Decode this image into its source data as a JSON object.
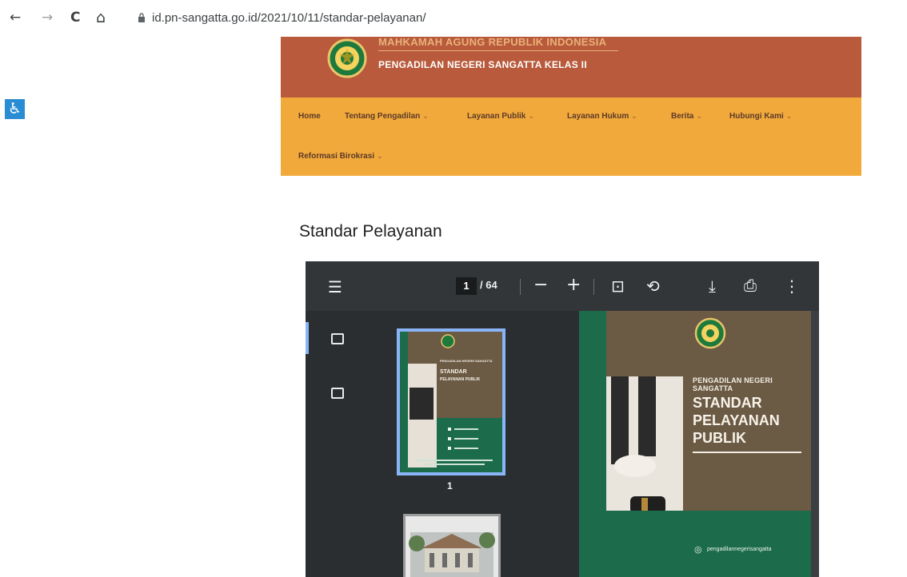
{
  "browser": {
    "url": "id.pn-sangatta.go.id/2021/10/11/standar-pelayanan/",
    "back": "←",
    "forward": "→",
    "reload": "C",
    "home": "⌂"
  },
  "accessibility": {
    "icon": "♿"
  },
  "header": {
    "top_text": "MAHKAMAH AGUNG REPUBLIK INDONESIA",
    "title": "PENGADILAN NEGERI SANGATTA KELAS II",
    "colors": {
      "header_bg": "#b85a3b",
      "menu_bg": "#f2a93b"
    }
  },
  "menu": {
    "items": [
      {
        "label": "Home",
        "dropdown": false
      },
      {
        "label": "Tentang Pengadilan",
        "dropdown": true
      },
      {
        "label": "Layanan Publik",
        "dropdown": true
      },
      {
        "label": "Layanan Hukum",
        "dropdown": true
      },
      {
        "label": "Berita",
        "dropdown": true
      },
      {
        "label": "Hubungi Kami",
        "dropdown": true
      },
      {
        "label": "Reformasi Birokrasi",
        "dropdown": true
      }
    ],
    "chevron": "⌄"
  },
  "main": {
    "title": "Standar Pelayanan"
  },
  "pdf": {
    "current_page": "1",
    "total_pages": "/ 64",
    "icons": {
      "menu": "☰",
      "zoom_out": "−",
      "zoom_in": "+",
      "fit": "⊡",
      "rotate": "⟲",
      "download": "⤓",
      "print": "⎙",
      "more": "⋮"
    },
    "thumbnail_label": "1",
    "page": {
      "subtitle": "PENGADILAN NEGERI SANGATTA",
      "title_line1": "STANDAR",
      "title_line2": "PELAYANAN PUBLIK",
      "social": "pengadilannegerisangatta"
    },
    "thumb1": {
      "subtitle": "PENGADILAN NEGERI SANGATTA",
      "title_line1": "STANDAR",
      "title_line2": "PELAYANAN PUBLIK"
    }
  }
}
